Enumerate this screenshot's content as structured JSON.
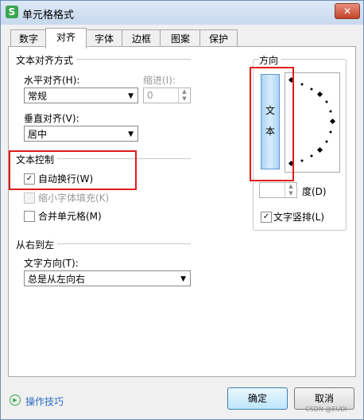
{
  "window": {
    "title": "单元格格式",
    "app_icon": "S",
    "close_label": "✕"
  },
  "tabs": [
    {
      "label": "数字"
    },
    {
      "label": "对齐"
    },
    {
      "label": "字体"
    },
    {
      "label": "边框"
    },
    {
      "label": "图案"
    },
    {
      "label": "保护"
    }
  ],
  "alignment": {
    "section_title": "文本对齐方式",
    "horizontal_label": "水平对齐(H):",
    "horizontal_value": "常规",
    "indent_label": "缩进(I):",
    "indent_value": "0",
    "vertical_label": "垂直对齐(V):",
    "vertical_value": "居中"
  },
  "text_control": {
    "section_title": "文本控制",
    "wrap_text_label": "自动换行(W)",
    "wrap_text_checked": true,
    "shrink_label": "缩小字体填充(K)",
    "shrink_checked": false,
    "merge_label": "合并单元格(M)",
    "merge_checked": false
  },
  "rtl": {
    "section_title": "从右到左",
    "direction_label": "文字方向(T):",
    "direction_value": "总是从左向右"
  },
  "orientation": {
    "section_title": "方向",
    "vertical_text_chars": [
      "文",
      "本"
    ],
    "degree_value": "",
    "degree_label": "度(D)",
    "vertical_text_label": "文字竖排(L)",
    "vertical_text_checked": true
  },
  "footer": {
    "tips_label": "操作技巧",
    "ok_label": "确定",
    "cancel_label": "取消"
  },
  "watermark": "CSDN @EUDI",
  "highlight_color": "#e11b1b"
}
